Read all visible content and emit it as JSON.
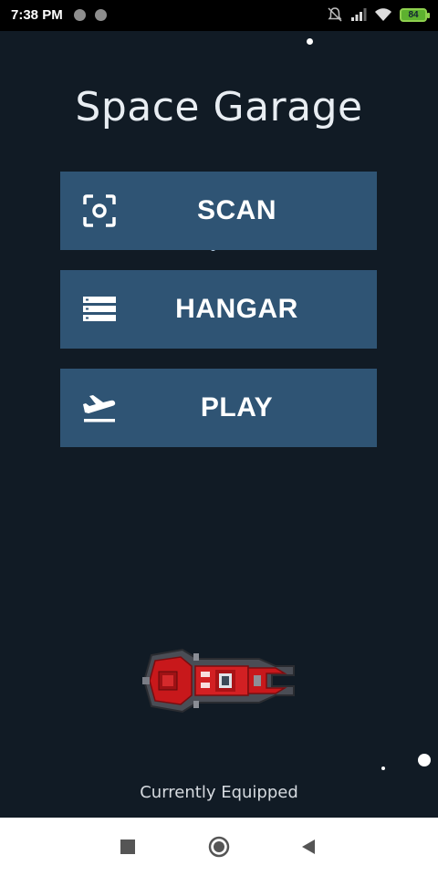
{
  "status_bar": {
    "time": "7:38 PM",
    "battery": "84"
  },
  "app": {
    "title": "Space Garage",
    "buttons": [
      {
        "label": "SCAN",
        "icon": "scan-icon"
      },
      {
        "label": "HANGAR",
        "icon": "hangar-list-icon"
      },
      {
        "label": "PLAY",
        "icon": "airplane-takeoff-icon"
      }
    ],
    "equipped_caption": "Currently Equipped"
  },
  "colors": {
    "background": "#111b25",
    "button": "#2f5474",
    "text": "#ffffff"
  }
}
